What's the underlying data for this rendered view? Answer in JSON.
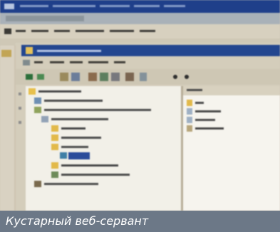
{
  "caption": {
    "text": "Кустарный веб-сервант"
  }
}
